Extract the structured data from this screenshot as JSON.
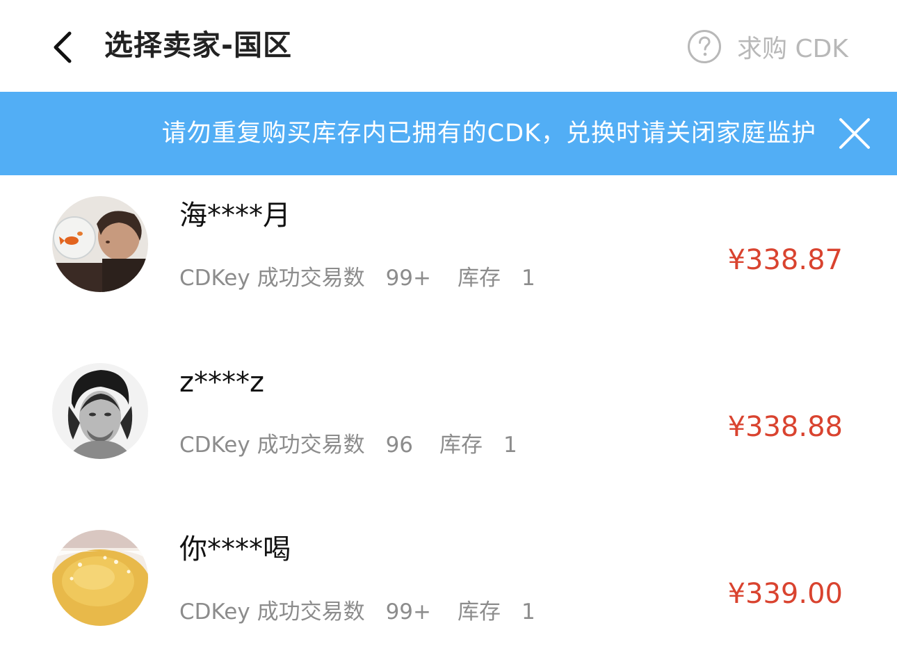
{
  "header": {
    "title": "选择卖家-国区",
    "back_icon": "chevron-left-icon",
    "help_icon": "question-circle-icon",
    "help_label": "求购 CDK"
  },
  "banner": {
    "text": "请勿重复购买库存内已拥有的CDK，兑换时请关闭家庭监护",
    "close_icon": "close-icon",
    "color": "#52aef5"
  },
  "colors": {
    "price": "#d9432f",
    "meta": "#8c8c8c",
    "title": "#222222"
  },
  "sellers": [
    {
      "name": "海****月",
      "trades_label": "CDKey 成功交易数",
      "trades": "99+",
      "stock_label": "库存",
      "stock": "1",
      "price": "¥338.87",
      "avatar": "goldfish-bowl-avatar"
    },
    {
      "name": "z****z",
      "trades_label": "CDKey 成功交易数",
      "trades": "96",
      "stock_label": "库存",
      "stock": "1",
      "price": "¥338.88",
      "avatar": "portrait-avatar"
    },
    {
      "name": "你****喝",
      "trades_label": "CDKey 成功交易数",
      "trades": "99+",
      "stock_label": "库存",
      "stock": "1",
      "price": "¥339.00",
      "avatar": "food-dish-avatar"
    }
  ]
}
